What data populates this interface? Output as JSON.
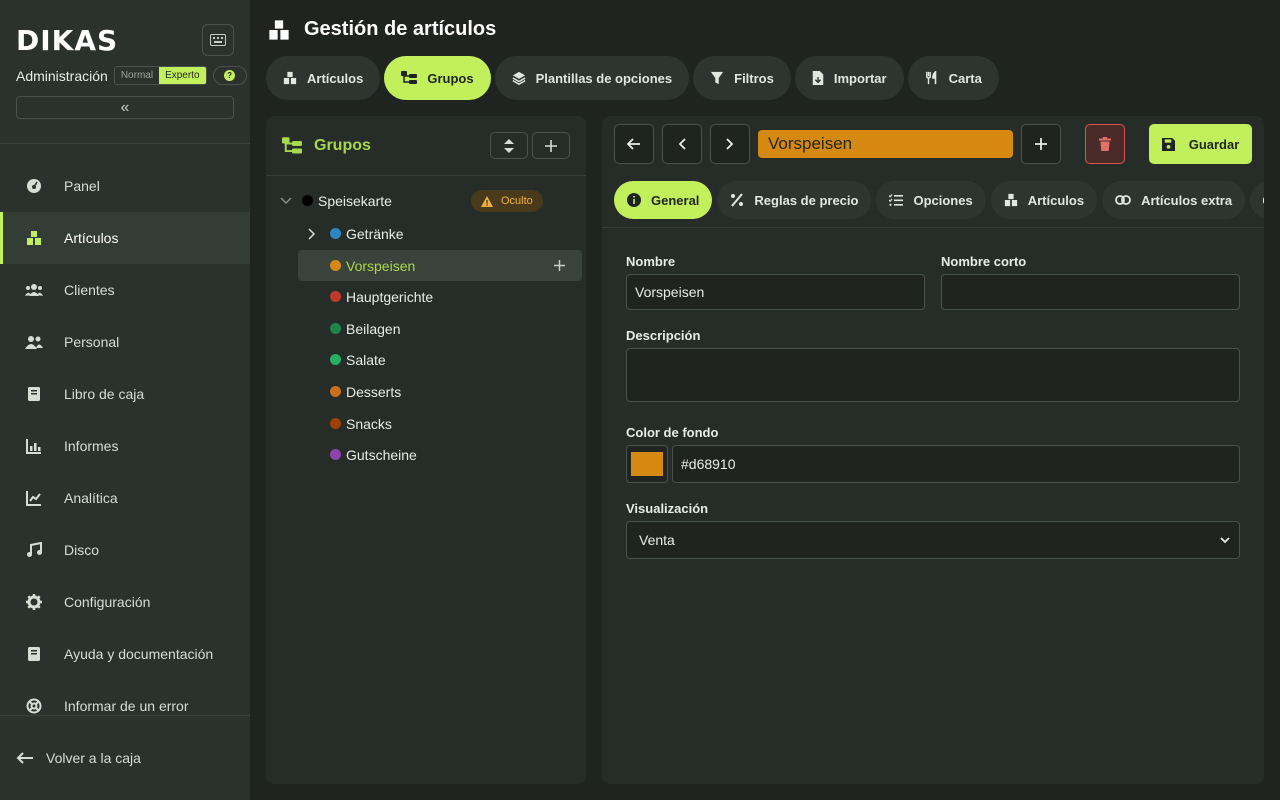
{
  "app": {
    "logo": "DIKAS",
    "admin_label": "Administración",
    "mode_normal": "Normal",
    "mode_expert": "Experto",
    "help_glyph": "?",
    "collapse_glyph": "«"
  },
  "nav": {
    "items": [
      {
        "label": "Panel",
        "icon": "gauge-icon"
      },
      {
        "label": "Artículos",
        "icon": "boxes-icon",
        "active": true
      },
      {
        "label": "Clientes",
        "icon": "users-icon"
      },
      {
        "label": "Personal",
        "icon": "user-group-icon"
      },
      {
        "label": "Libro de caja",
        "icon": "book-icon"
      },
      {
        "label": "Informes",
        "icon": "bar-chart-icon"
      },
      {
        "label": "Analítica",
        "icon": "line-chart-icon"
      },
      {
        "label": "Disco",
        "icon": "music-icon"
      },
      {
        "label": "Configuración",
        "icon": "gear-icon"
      },
      {
        "label": "Ayuda y documentación",
        "icon": "book-icon"
      },
      {
        "label": "Informar de un error",
        "icon": "lifebuoy-icon"
      }
    ],
    "back_label": "Volver a la caja"
  },
  "header": {
    "title": "Gestión de artículos"
  },
  "tabs": [
    {
      "label": "Artículos",
      "icon": "boxes-icon"
    },
    {
      "label": "Grupos",
      "icon": "tree-icon",
      "active": true
    },
    {
      "label": "Plantillas de opciones",
      "icon": "layers-icon"
    },
    {
      "label": "Filtros",
      "icon": "filter-icon"
    },
    {
      "label": "Importar",
      "icon": "file-import-icon"
    },
    {
      "label": "Carta",
      "icon": "utensils-icon"
    }
  ],
  "tree": {
    "title": "Grupos",
    "root": {
      "label": "Speisekarte",
      "color": "#000000",
      "badge": "Oculto"
    },
    "children": [
      {
        "label": "Getränke",
        "color": "#2e86c1"
      },
      {
        "label": "Vorspeisen",
        "color": "#d68910",
        "selected": true
      },
      {
        "label": "Hauptgerichte",
        "color": "#c0392b"
      },
      {
        "label": "Beilagen",
        "color": "#1e8449"
      },
      {
        "label": "Salate",
        "color": "#27ae60"
      },
      {
        "label": "Desserts",
        "color": "#ca6f1e"
      },
      {
        "label": "Snacks",
        "color": "#a04000"
      },
      {
        "label": "Gutscheine",
        "color": "#8e44ad"
      }
    ]
  },
  "editor": {
    "group_name": "Vorspeisen",
    "save_label": "Guardar",
    "sub_tabs": [
      {
        "label": "General",
        "icon": "info-icon",
        "active": true
      },
      {
        "label": "Reglas de precio",
        "icon": "percent-icon"
      },
      {
        "label": "Opciones",
        "icon": "list-check-icon"
      },
      {
        "label": "Artículos",
        "icon": "boxes-icon"
      },
      {
        "label": "Artículos extra",
        "icon": "link-icon"
      },
      {
        "label": "",
        "icon": "printer-icon"
      }
    ],
    "fields": {
      "name_label": "Nombre",
      "name_value": "Vorspeisen",
      "short_label": "Nombre corto",
      "short_value": "",
      "desc_label": "Descripción",
      "desc_value": "",
      "color_label": "Color de fondo",
      "color_value": "#d68910",
      "display_label": "Visualización",
      "display_value": "Venta"
    }
  },
  "colors": {
    "accent": "#c2f05c",
    "accent_text": "#a7d94a",
    "group_color": "#d68910",
    "danger": "#d9534f"
  }
}
